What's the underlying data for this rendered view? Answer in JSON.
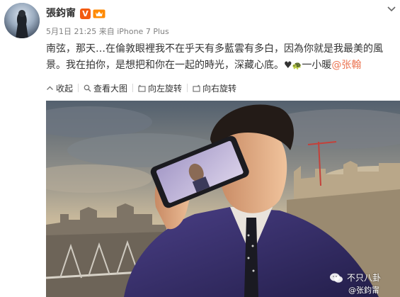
{
  "post": {
    "author_name": "張鈞甯",
    "vip_badge": "V",
    "timestamp": "5月1日 21:25",
    "source": "来自 iPhone 7 Plus",
    "text_main": "南弦，那天…在倫敦眼裡我不在乎天有多藍雲有多白，因為你就是我最美的風景。我在拍你，是想把和你在一起的時光，深藏心底。",
    "heart_emoji": "♥",
    "turtle_emoji": "🐢",
    "text_sign": "一小暖",
    "mention": "@张翰"
  },
  "toolbar": {
    "collapse_label": "收起",
    "view_large_label": "查看大图",
    "rotate_left_label": "向左旋转",
    "rotate_right_label": "向右旋转"
  },
  "watermark": {
    "name": "不只八卦",
    "handle": "@张鈞甯"
  },
  "icons": {
    "avatar": "avatar-photo",
    "vip": "vip-badge-icon",
    "level": "member-level-icon",
    "dropdown": "chevron-down-icon",
    "collapse": "collapse-arrow-icon",
    "view_large": "magnify-icon",
    "rotate_left": "rotate-left-icon",
    "rotate_right": "rotate-right-icon",
    "wechat": "wechat-icon"
  },
  "colors": {
    "mention": "#eb7350",
    "vip": "#f35b10",
    "meta_text": "#808080",
    "body_text": "#333333"
  }
}
